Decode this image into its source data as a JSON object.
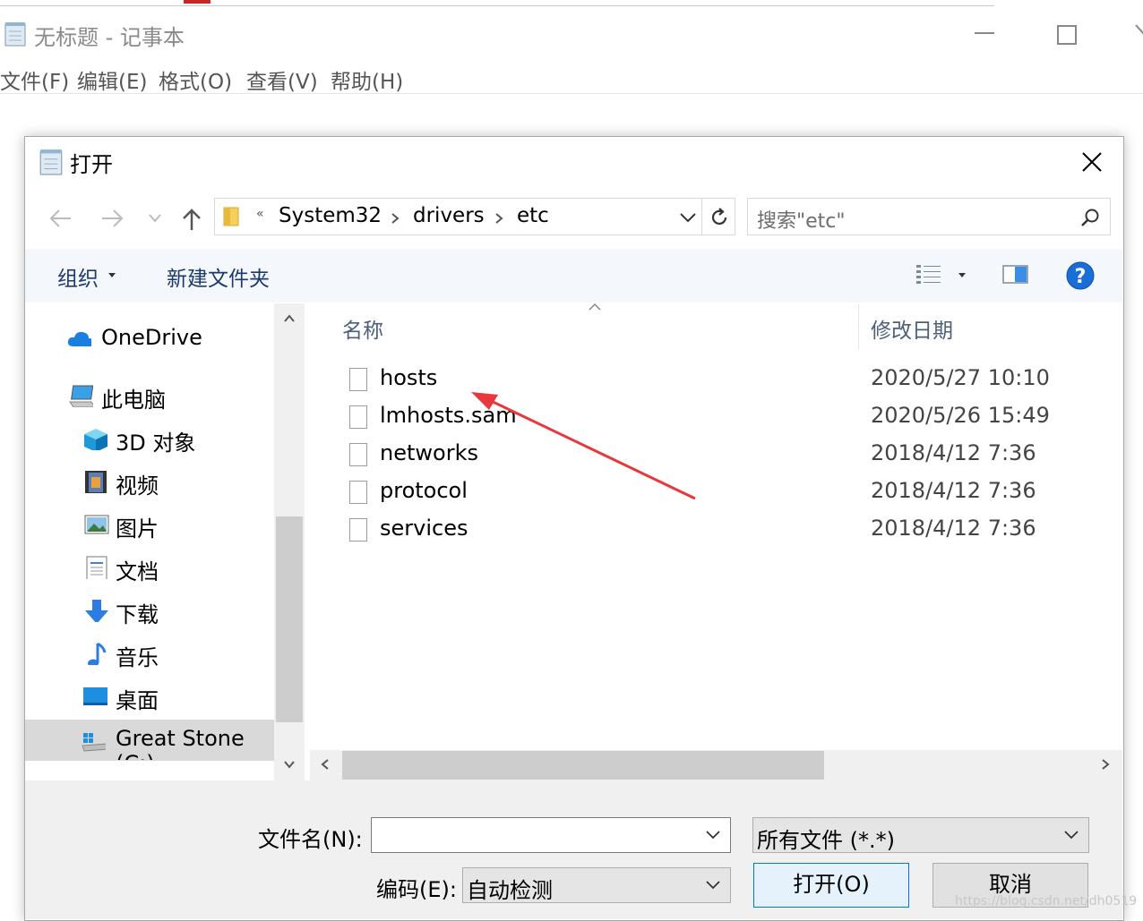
{
  "notepad": {
    "title": "无标题 - 记事本",
    "menu": [
      "文件(F)",
      "编辑(E)",
      "格式(O)",
      "查看(V)",
      "帮助(H)"
    ]
  },
  "dialog": {
    "title": "打开",
    "breadcrumb": {
      "overflow": "«",
      "items": [
        "System32",
        "drivers",
        "etc"
      ]
    },
    "search_placeholder": "搜索\"etc\"",
    "toolbar": {
      "organize": "组织",
      "new_folder": "新建文件夹"
    },
    "nav": {
      "onedrive": "OneDrive",
      "this_pc": "此电脑",
      "items": [
        "3D 对象",
        "视频",
        "图片",
        "文档",
        "下载",
        "音乐",
        "桌面",
        "Great Stone (C:)"
      ]
    },
    "columns": {
      "name": "名称",
      "date": "修改日期"
    },
    "files": [
      {
        "name": "hosts",
        "date": "2020/5/27 10:10"
      },
      {
        "name": "lmhosts.sam",
        "date": "2020/5/26 15:49"
      },
      {
        "name": "networks",
        "date": "2018/4/12 7:36"
      },
      {
        "name": "protocol",
        "date": "2018/4/12 7:36"
      },
      {
        "name": "services",
        "date": "2018/4/12 7:36"
      }
    ],
    "filename_label": "文件名(N):",
    "filename_value": "",
    "filetype": "所有文件  (*.*)",
    "encoding_label": "编码(E):",
    "encoding_value": "自动检测",
    "open_button": "打开(O)",
    "cancel_button": "取消"
  },
  "watermark": "https://blog.csdn.net/dh0519",
  "colors": {
    "annotation_arrow": "#e8383d",
    "toolbar_bg": "#f4f7fc",
    "help_blue": "#1a6fd6"
  }
}
